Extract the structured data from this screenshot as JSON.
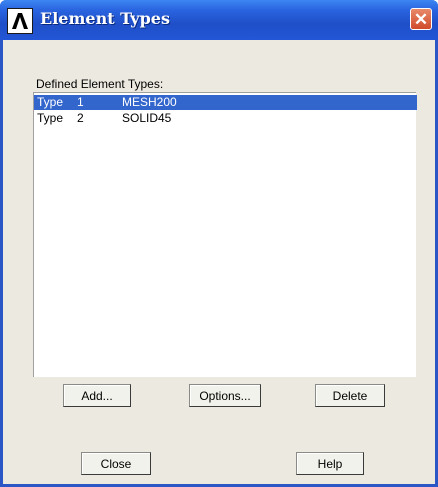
{
  "window": {
    "title": "Element Types",
    "close_glyph": "✕",
    "app_icon_glyph": "Λ"
  },
  "list": {
    "label": "Defined Element Types:",
    "rows": [
      {
        "type": "Type",
        "number": "1",
        "element": "MESH200",
        "selected": true
      },
      {
        "type": "Type",
        "number": "2",
        "element": "SOLID45",
        "selected": false
      }
    ]
  },
  "buttons": {
    "add": "Add...",
    "options": "Options...",
    "delete": "Delete",
    "close": "Close",
    "help": "Help"
  },
  "colors": {
    "title_bar": "#2356d6",
    "selection": "#3366cc",
    "dialog_bg": "#eceae0"
  },
  "icons": {
    "app": "ansys-logo-icon",
    "close": "close-icon"
  }
}
